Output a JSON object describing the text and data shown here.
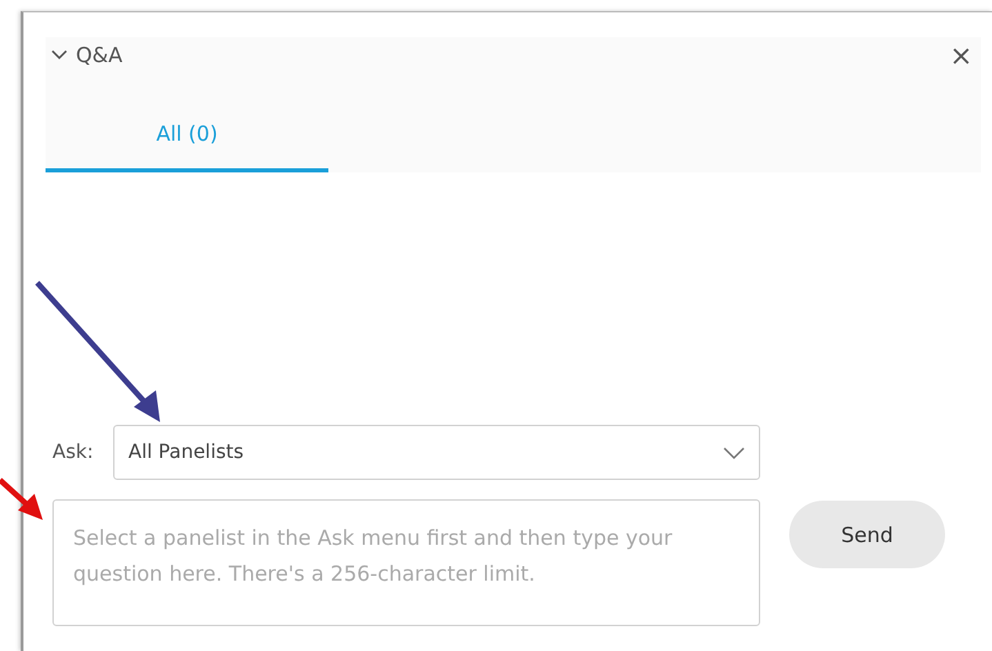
{
  "panel": {
    "title": "Q&A",
    "expanded": true,
    "close": "×"
  },
  "tabs": [
    {
      "label": "All (0)",
      "selected": true
    }
  ],
  "ask": {
    "label": "Ask:",
    "value": "All Panelists"
  },
  "question": {
    "placeholder": "Select a panelist in the Ask menu first and then type your question here. There's a 256-character limit."
  },
  "buttons": [
    "Send"
  ]
}
